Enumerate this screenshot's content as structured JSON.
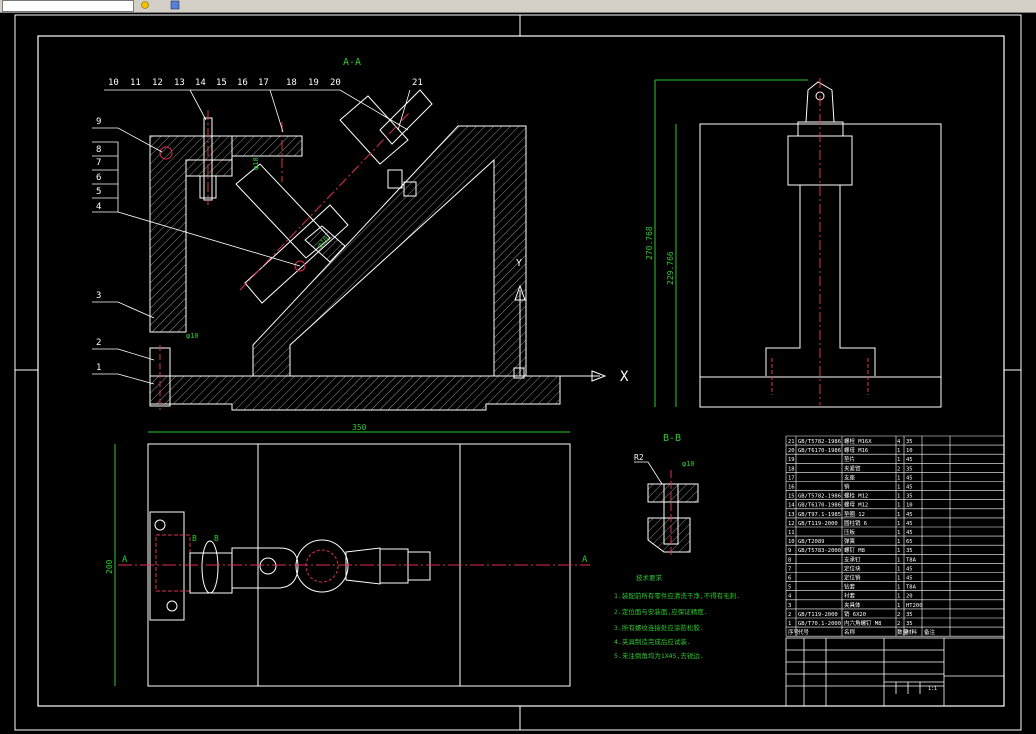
{
  "toolbar": {
    "field_value": "",
    "icons": [
      "layer-state-icon",
      "layer-color-icon"
    ]
  },
  "drawing": {
    "section_aa_title": "A-A",
    "section_bb_title": "B-B",
    "part_numbers_top": [
      "10",
      "11",
      "12",
      "13",
      "14",
      "15",
      "16",
      "17",
      "18",
      "19",
      "20",
      "21"
    ],
    "part_numbers_left": [
      "9",
      "8",
      "7",
      "6",
      "5",
      "4",
      "3",
      "2",
      "1"
    ],
    "dim_350": "350",
    "dim_200": "200",
    "dim_270": "270.768",
    "dim_229": "229.766",
    "axis_x": "X",
    "axis_y": "Y",
    "section_marker_a_left": "A",
    "section_marker_a_right": "A",
    "marker_b_left": "B",
    "marker_b_right": "B",
    "r2": "R2",
    "phi_label": "φ10",
    "tech_title": "技术要求",
    "tech_notes": [
      "1.装配前所有零件应清洗干净,不得有毛刺.",
      "2.定位面与安装面,应保证精度.",
      "3.所有螺纹连接处应涂防松胶.",
      "4.夹具制造完成后应试装.",
      "5.未注倒角均为1X45,去锐边."
    ]
  },
  "bom": {
    "rows": [
      [
        "21",
        "GB/T5782-1986",
        "螺栓 M16X",
        "4",
        "35",
        ""
      ],
      [
        "20",
        "GB/T6170-1986",
        "螺母 M16",
        "1",
        "10",
        ""
      ],
      [
        "19",
        "",
        "垫片",
        "1",
        "45",
        ""
      ],
      [
        "18",
        "",
        "夹紧臂",
        "2",
        "35",
        ""
      ],
      [
        "17",
        "",
        "支座",
        "1",
        "45",
        ""
      ],
      [
        "16",
        "",
        "销",
        "1",
        "45",
        ""
      ],
      [
        "15",
        "GB/T5782-1986",
        "螺栓 M12",
        "1",
        "35",
        ""
      ],
      [
        "14",
        "GB/T6170-1986",
        "螺母 M12",
        "1",
        "10",
        ""
      ],
      [
        "13",
        "GB/T97.1-1985",
        "垫圈 12",
        "1",
        "45",
        ""
      ],
      [
        "12",
        "GB/T119-2000",
        "圆柱销 6",
        "1",
        "45",
        ""
      ],
      [
        "11",
        "",
        "压板",
        "1",
        "45",
        ""
      ],
      [
        "10",
        "GB/T2089",
        "弹簧",
        "1",
        "65",
        ""
      ],
      [
        "9",
        "GB/T5783-2000",
        "螺钉 M8",
        "1",
        "35",
        ""
      ],
      [
        "8",
        "",
        "支承钉",
        "1",
        "T8A",
        ""
      ],
      [
        "7",
        "",
        "定位块",
        "1",
        "45",
        ""
      ],
      [
        "6",
        "",
        "定位销",
        "1",
        "45",
        ""
      ],
      [
        "5",
        "",
        "钻套",
        "1",
        "T8A",
        ""
      ],
      [
        "4",
        "",
        "衬套",
        "1",
        "20",
        ""
      ],
      [
        "3",
        "",
        "夹具体",
        "1",
        "HT200",
        ""
      ],
      [
        "2",
        "GB/T119-2000",
        "销 6X20",
        "2",
        "35",
        ""
      ],
      [
        "1",
        "GB/T70.1-2000",
        "内六角螺钉 M8",
        "2",
        "35",
        ""
      ]
    ],
    "header": [
      "序号",
      "代号",
      "名称",
      "数量",
      "材料",
      "备注"
    ],
    "scale_value": "1:1"
  }
}
